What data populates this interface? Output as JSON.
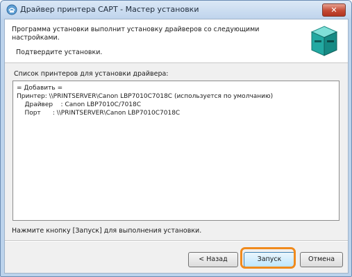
{
  "window": {
    "title": "Драйвер принтера CAPT - Мастер установки",
    "close_label": "✕",
    "icon": "installer-icon"
  },
  "header": {
    "line1": "Программа установки выполнит установку драйверов со следующими",
    "line2": "настройками.",
    "sub": "Подтвердите установки.",
    "icon": "printer-box-icon"
  },
  "list": {
    "label": "Список принтеров для установки драйвера:",
    "lines": [
      "= Добавить =",
      "Принтер: \\\\PRINTSERVER\\Canon LBP7010C7018C (используется по умолчанию)",
      "    Драйвер    : Canon LBP7010C/7018C",
      "    Порт      : \\\\PRINTSERVER\\Canon LBP7010C7018C"
    ]
  },
  "instruction": "Нажмите кнопку [Запуск] для выполнения установки.",
  "buttons": {
    "back": "< Назад",
    "start": "Запуск",
    "cancel": "Отмена"
  },
  "colors": {
    "highlight": "#f08a1c",
    "close": "#c44a34"
  }
}
